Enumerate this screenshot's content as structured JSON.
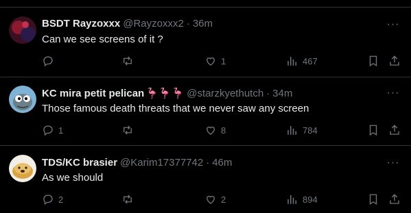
{
  "tweets": [
    {
      "name": "BSDT Rayzoxxx",
      "handle": "@Rayzoxxx2",
      "time": "36m",
      "emoji": "",
      "text": "Can we see screens of it ?",
      "replies": "",
      "retweets": "",
      "likes": "1",
      "views": "467"
    },
    {
      "name": "KC mira petit pelican",
      "handle": "@starzkyethutch",
      "time": "34m",
      "emoji": "🦩🦩🦩",
      "text": "Those famous death threats that we never saw any screen",
      "replies": "1",
      "retweets": "",
      "likes": "8",
      "views": "784"
    },
    {
      "name": "TDS/KC brasier",
      "handle": "@Karim17377742",
      "time": "46m",
      "emoji": "",
      "text": "As we should",
      "replies": "2",
      "retweets": "",
      "likes": "2",
      "views": "894"
    }
  ],
  "separator": "·",
  "more_glyph": "···",
  "icons": {
    "reply": "reply-icon",
    "retweet": "retweet-icon",
    "like": "heart-icon",
    "views": "views-icon",
    "bookmark": "bookmark-icon",
    "share": "share-icon",
    "more": "more-icon"
  }
}
